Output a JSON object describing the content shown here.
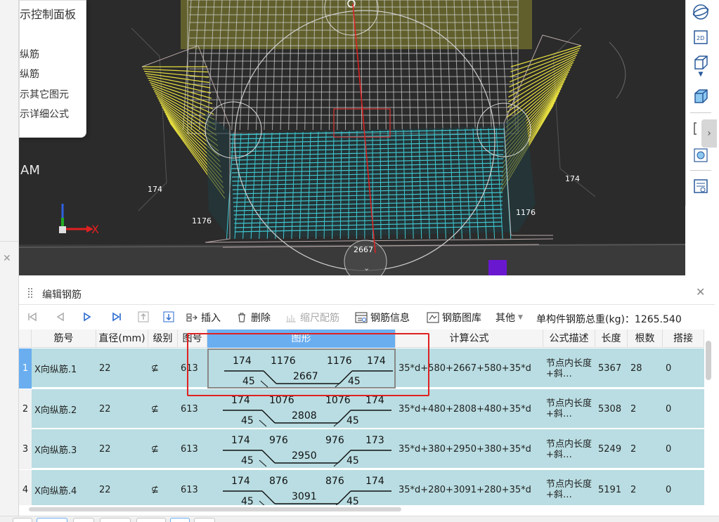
{
  "control_panel": {
    "title": "示控制面板",
    "items": [
      "纵筋",
      "纵筋",
      "示其它图元",
      "示详细公式"
    ]
  },
  "viewport": {
    "label_am": "AM",
    "axis_x": "X",
    "labels": {
      "left_174": "174",
      "left_1176": "1176",
      "right_174": "174",
      "right_1176": "1176",
      "bottom_2667": "2667"
    }
  },
  "panel": {
    "title": "编辑钢筋"
  },
  "toolbar": {
    "insert": "插入",
    "delete": "删除",
    "scale": "缩尺配筋",
    "info": "钢筋信息",
    "library": "钢筋图库",
    "other": "其他",
    "weight_label": "单构件钢筋总重(kg)：",
    "weight_value": "1265.540"
  },
  "table": {
    "columns": [
      "筋号",
      "直径(mm)",
      "级别",
      "图号",
      "图形",
      "计算公式",
      "公式描述",
      "长度",
      "根数",
      "搭接"
    ],
    "rows": [
      {
        "index": "1",
        "name": "X向纵筋.1",
        "diameter": "22",
        "grade": "⊈",
        "figure": "613",
        "shape": {
          "l1": "174",
          "l2": "1176",
          "mid": "2667",
          "r2": "1176",
          "r1": "174",
          "lb": "45",
          "rb": "45"
        },
        "formula": "35*d+580+2667+580+35*d",
        "desc": "节点内长度+斜…",
        "length": "5367",
        "count": "28",
        "lap": "0"
      },
      {
        "index": "2",
        "name": "X向纵筋.2",
        "diameter": "22",
        "grade": "⊈",
        "figure": "613",
        "shape": {
          "l1": "174",
          "l2": "1076",
          "mid": "2808",
          "r2": "1076",
          "r1": "174",
          "lb": "45",
          "rb": "45"
        },
        "formula": "35*d+480+2808+480+35*d",
        "desc": "节点内长度+斜…",
        "length": "5308",
        "count": "2",
        "lap": "0"
      },
      {
        "index": "3",
        "name": "X向纵筋.3",
        "diameter": "22",
        "grade": "⊈",
        "figure": "613",
        "shape": {
          "l1": "174",
          "l2": "976",
          "mid": "2950",
          "r2": "976",
          "r1": "173",
          "lb": "45",
          "rb": "45"
        },
        "formula": "35*d+380+2950+380+35*d",
        "desc": "节点内长度+斜…",
        "length": "5249",
        "count": "2",
        "lap": "0"
      },
      {
        "index": "4",
        "name": "X向纵筋.4",
        "diameter": "22",
        "grade": "⊈",
        "figure": "613",
        "shape": {
          "l1": "174",
          "l2": "876",
          "mid": "3091",
          "r2": "876",
          "r1": "174",
          "lb": "45",
          "rb": "45"
        },
        "formula": "35*d+280+3091+280+35*d",
        "desc": "节点内长度+斜…",
        "length": "5191",
        "count": "2",
        "lap": "0"
      }
    ]
  },
  "colors": {
    "row_bg": "#b9dde2",
    "header_active": "#6aaef0",
    "highlight": "#e02020",
    "mesh_cyan": "#3fc8d0",
    "mesh_yellow": "#e8e040",
    "viewport_bg": "#2b2b2b"
  }
}
